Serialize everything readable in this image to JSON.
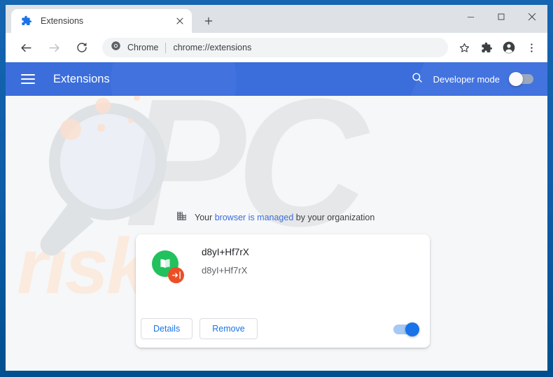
{
  "window": {
    "controls": {
      "minimize": "minimize-icon",
      "maximize": "maximize-icon",
      "close": "close-icon"
    }
  },
  "tabstrip": {
    "active_tab": {
      "title": "Extensions",
      "favicon": "puzzle-piece-icon",
      "close": "close-icon"
    },
    "new_tab": "plus-icon"
  },
  "toolbar": {
    "back": "back-arrow-icon",
    "forward": "forward-arrow-icon",
    "reload": "reload-icon",
    "omnibox": {
      "site_icon": "chrome-logo-icon",
      "site_label": "Chrome",
      "url": "chrome://extensions"
    },
    "bookmark": "star-icon",
    "extensions": "puzzle-piece-icon",
    "profile": "account-avatar-icon",
    "menu": "three-dot-menu-icon"
  },
  "ext_header": {
    "menu": "hamburger-icon",
    "title": "Extensions",
    "search": "search-icon",
    "dev_mode_label": "Developer mode",
    "dev_mode_on": false
  },
  "page": {
    "managed_banner": {
      "icon": "organization-building-icon",
      "prefix": "Your ",
      "link": "browser is managed",
      "suffix": " by your organization"
    },
    "extension_card": {
      "name": "d8yI+Hf7rX",
      "description": "d8yI+Hf7rX",
      "icon": "open-book-icon",
      "badge_icon": "login-arrow-icon",
      "details_label": "Details",
      "remove_label": "Remove",
      "enabled": true
    },
    "watermark": {
      "logo": "magnifier-icon",
      "text_top": "PC",
      "text_bottom": "risk.com"
    }
  },
  "colors": {
    "window_border": "#0b5394",
    "ext_header_blue": "#3b6ddb",
    "link_blue": "#1a73e8",
    "toggle_on": "#1a73e8",
    "ext_icon_green": "#22c15e",
    "ext_badge_orange": "#ec4f26",
    "page_bg": "#f6f7f9",
    "tabstrip_bg": "#dee1e6"
  }
}
